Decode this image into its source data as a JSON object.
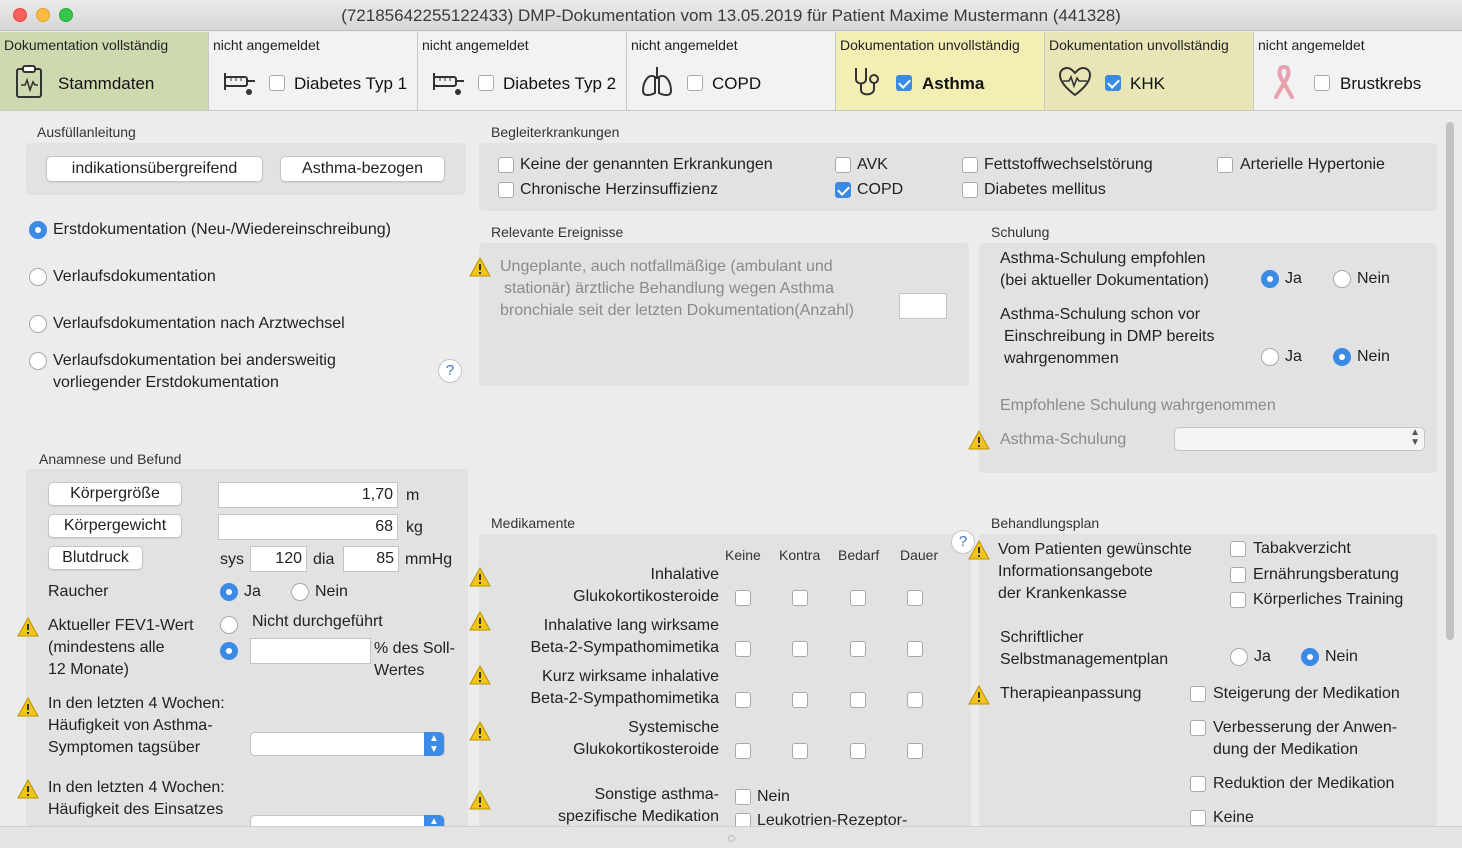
{
  "window": {
    "title": "(72185642255122433) DMP-Dokumentation vom 13.05.2019 für Patient Maxime Mustermann (441328)"
  },
  "tabs": [
    {
      "status": "Dokumentation vollständig",
      "label": "Stammdaten",
      "checked": null,
      "icon": "clipboard-icon",
      "color": "#cfd9b0"
    },
    {
      "status": "nicht angemeldet",
      "label": "Diabetes Typ 1",
      "checked": false,
      "icon": "syringe-icon",
      "color": "#f2f2f2"
    },
    {
      "status": "nicht angemeldet",
      "label": "Diabetes Typ 2",
      "checked": false,
      "icon": "syringe-icon",
      "color": "#f2f2f2"
    },
    {
      "status": "nicht angemeldet",
      "label": "COPD",
      "checked": false,
      "icon": "lungs-icon",
      "color": "#f2f2f2"
    },
    {
      "status": "Dokumentation unvollständig",
      "label": "Asthma",
      "checked": true,
      "icon": "stethoscope-icon",
      "color": "#f3eeb4"
    },
    {
      "status": "Dokumentation unvollständig",
      "label": "KHK",
      "checked": true,
      "icon": "heart-icon",
      "color": "#e8e6b6"
    },
    {
      "status": "nicht angemeldet",
      "label": "Brustkrebs",
      "checked": false,
      "icon": "ribbon-icon",
      "color": "#f2f2f2"
    }
  ],
  "anleitung": {
    "heading": "Ausfüllanleitung",
    "btn1": "indikationsübergreifend",
    "btn2": "Asthma-bezogen"
  },
  "doctype": {
    "opt1": "Erstdokumentation (Neu-/Wiedereinschreibung)",
    "opt2": "Verlaufsdokumentation",
    "opt3": "Verlaufsdokumentation nach Arztwechsel",
    "opt4a": "Verlaufsdokumentation bei andersweitig",
    "opt4b": "vorliegender Erstdokumentation",
    "selected": "opt1",
    "help": "?"
  },
  "begleit": {
    "heading": "Begleiterkrankungen",
    "items": [
      {
        "label": "Keine der genannten Erkrankungen",
        "checked": false
      },
      {
        "label": "AVK",
        "checked": false
      },
      {
        "label": "Fettstoffwechselstörung",
        "checked": false
      },
      {
        "label": "Arterielle Hypertonie",
        "checked": false
      },
      {
        "label": "Chronische Herzinsuffizienz",
        "checked": false
      },
      {
        "label": "COPD",
        "checked": true
      },
      {
        "label": "Diabetes mellitus",
        "checked": false
      }
    ]
  },
  "ereignisse": {
    "heading": "Relevante Ereignisse",
    "l1": "Ungeplante, auch notfallmäßige (ambulant und",
    "l2": "stationär) ärztliche Behandlung wegen Asthma",
    "l3": "bronchiale seit der letzten Dokumentation(Anzahl)",
    "value": ""
  },
  "schulung": {
    "heading": "Schulung",
    "q1a": "Asthma-Schulung empfohlen",
    "q1b": "(bei aktueller Dokumentation)",
    "q1_answer": "Ja",
    "q2a": "Asthma-Schulung schon vor",
    "q2b": "Einschreibung in DMP bereits",
    "q2c": "wahrgenommen",
    "q2_answer": "Nein",
    "ja": "Ja",
    "nein": "Nein",
    "wahrgenommen_heading": "Empfohlene Schulung wahrgenommen",
    "asthma_schulung_label": "Asthma-Schulung",
    "asthma_schulung_value": ""
  },
  "anamnese": {
    "heading": "Anamnese und Befund",
    "groesse_label": "Körpergröße",
    "groesse": "1,70",
    "groesse_unit": "m",
    "gewicht_label": "Körpergewicht",
    "gewicht": "68",
    "gewicht_unit": "kg",
    "blutdruck_label": "Blutdruck",
    "sys_label": "sys",
    "sys": "120",
    "dia_label": "dia",
    "dia": "85",
    "bp_unit": "mmHg",
    "raucher_label": "Raucher",
    "raucher": "Ja",
    "ja": "Ja",
    "nein": "Nein",
    "fev_l1": "Aktueller FEV1-Wert",
    "fev_l2": "(mindestens alle",
    "fev_l3": "12 Monate)",
    "fev_opt1": "Nicht durchgeführt",
    "fev_unit1": "% des Soll-",
    "fev_unit2": "Wertes",
    "fev_value": "",
    "symp_l1": "In den letzten 4 Wochen:",
    "symp_l2": "Häufigkeit von Asthma-",
    "symp_l3": "Symptomen tagsüber",
    "symp_value": "",
    "eins_l1": "In den letzten 4 Wochen:",
    "eins_l2": "Häufigkeit des Einsatzes"
  },
  "medikamente": {
    "heading": "Medikamente",
    "columns": [
      "Keine",
      "Kontra",
      "Bedarf",
      "Dauer"
    ],
    "rows": [
      {
        "l1": "Inhalative",
        "l2": "Glukokortikosteroide"
      },
      {
        "l1": "Inhalative lang wirksame",
        "l2": "Beta-2-Sympathomimetika"
      },
      {
        "l1": "Kurz wirksame inhalative",
        "l2": "Beta-2-Sympathomimetika"
      },
      {
        "l1": "Systemische",
        "l2": "Glukokortikosteroide"
      }
    ],
    "sonst_l1": "Sonstige asthma-",
    "sonst_l2": "spezifische Medikation",
    "sonst_opt1": "Nein",
    "sonst_opt2": "Leukotrien-Rezeptor-"
  },
  "behandlung": {
    "heading": "Behandlungsplan",
    "info_l1": "Vom Patienten gewünschte",
    "info_l2": "Informationsangebote",
    "info_l3": "der Krankenkasse",
    "info_opts": [
      "Tabakverzicht",
      "Ernährungsberatung",
      "Körperliches Training"
    ],
    "plan_l1": "Schriftlicher",
    "plan_l2": "Selbstmanagementplan",
    "plan_answer": "Nein",
    "ja": "Ja",
    "nein": "Nein",
    "therapie_label": "Therapieanpassung",
    "therapie_opt1": "Steigerung der Medikation",
    "therapie_opt2a": "Verbesserung der Anwen-",
    "therapie_opt2b": "dung der Medikation",
    "therapie_opt3": "Reduktion der Medikation",
    "therapie_opt4": "Keine",
    "help": "?"
  },
  "colors": {
    "accent": "#3b8ae6",
    "warning": "#f0c419",
    "tab_complete": "#cfd9b0",
    "tab_incomplete": "#f3eeb4"
  }
}
